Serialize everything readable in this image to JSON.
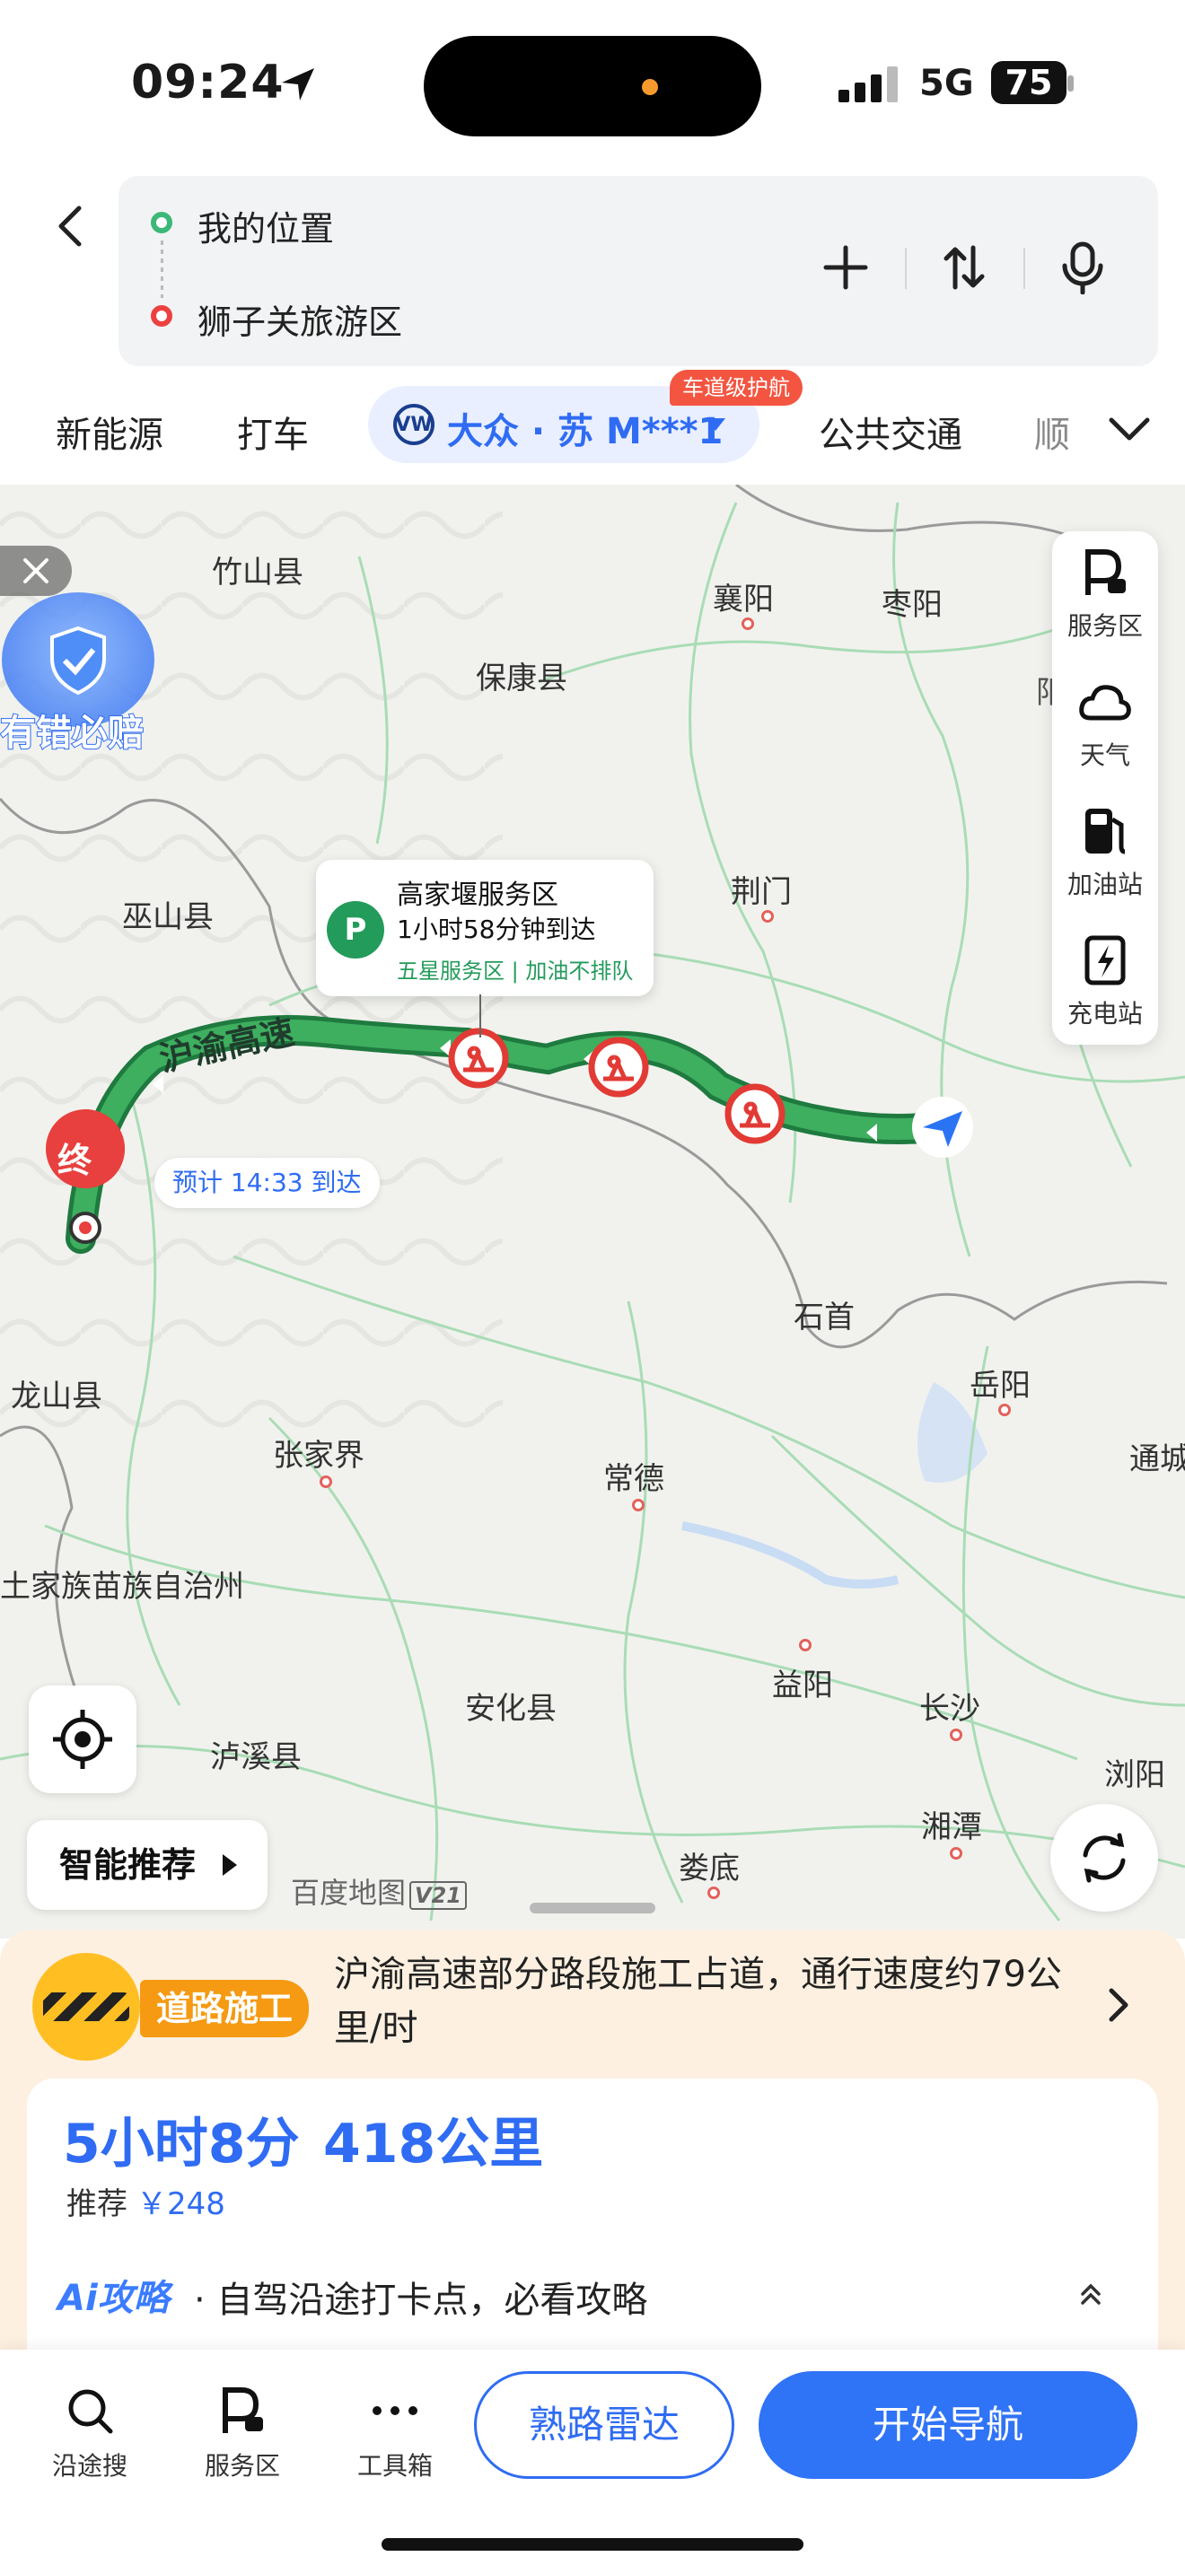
{
  "status_bar": {
    "time": "09:24",
    "network": "5G",
    "battery": "75"
  },
  "route": {
    "from": "我的位置",
    "to": "狮子关旅游区"
  },
  "mode_tabs": {
    "ev": "新能源",
    "taxi": "打车",
    "car": "大众 · 苏 M***1",
    "car_brand": "VW",
    "guard_badge": "车道级护航",
    "transit": "公共交通",
    "partial": "顺"
  },
  "map": {
    "cities": [
      {
        "name": "竹山县"
      },
      {
        "name": "襄阳"
      },
      {
        "name": "枣阳"
      },
      {
        "name": "保康县"
      },
      {
        "name": "巫山县"
      },
      {
        "name": "荆门"
      },
      {
        "name": "石首"
      },
      {
        "name": "岳阳"
      },
      {
        "name": "龙山县"
      },
      {
        "name": "张家界"
      },
      {
        "name": "常德"
      },
      {
        "name": "通城"
      },
      {
        "name": "土家族苗族自治州"
      },
      {
        "name": "益阳"
      },
      {
        "name": "长沙"
      },
      {
        "name": "安化县"
      },
      {
        "name": "泸溪县"
      },
      {
        "name": "浏阳"
      },
      {
        "name": "湘潭"
      },
      {
        "name": "娄底"
      },
      {
        "name": "阳"
      }
    ],
    "promise": "有错必赔",
    "side_panel": [
      {
        "label": "服务区",
        "icon": "service-area-icon"
      },
      {
        "label": "天气",
        "icon": "weather-icon"
      },
      {
        "label": "加油站",
        "icon": "gas-station-icon"
      },
      {
        "label": "充电站",
        "icon": "charging-station-icon"
      }
    ],
    "poi": {
      "name": "高家堰服务区",
      "eta": "1小时58分钟到达",
      "tags": "五星服务区 | 加油不排队",
      "icon_text": "P"
    },
    "road_name": "沪渝高速",
    "end_marker": "终",
    "eta_chip": "预计 14:33 到达",
    "smart": "智能推荐",
    "watermark": "百度地图",
    "watermark_version": "V21"
  },
  "alert": {
    "label": "道路施工",
    "text": "沪渝高速部分路段施工占道，通行速度约79公里/时"
  },
  "summary": {
    "duration": "5小时8分",
    "distance": "418公里",
    "recommend_label": "推荐",
    "price": "￥248",
    "ai_tag": "Ai攻略",
    "ai_text": "· 自驾沿途打卡点，必看攻略"
  },
  "actions": {
    "search": "沿途搜",
    "service": "服务区",
    "tools": "工具箱",
    "radar": "熟路雷达",
    "start": "开始导航"
  },
  "colors": {
    "accent": "#2f6cf3",
    "route": "#35a35a",
    "alert": "#f59a12",
    "end": "#e8403e"
  }
}
